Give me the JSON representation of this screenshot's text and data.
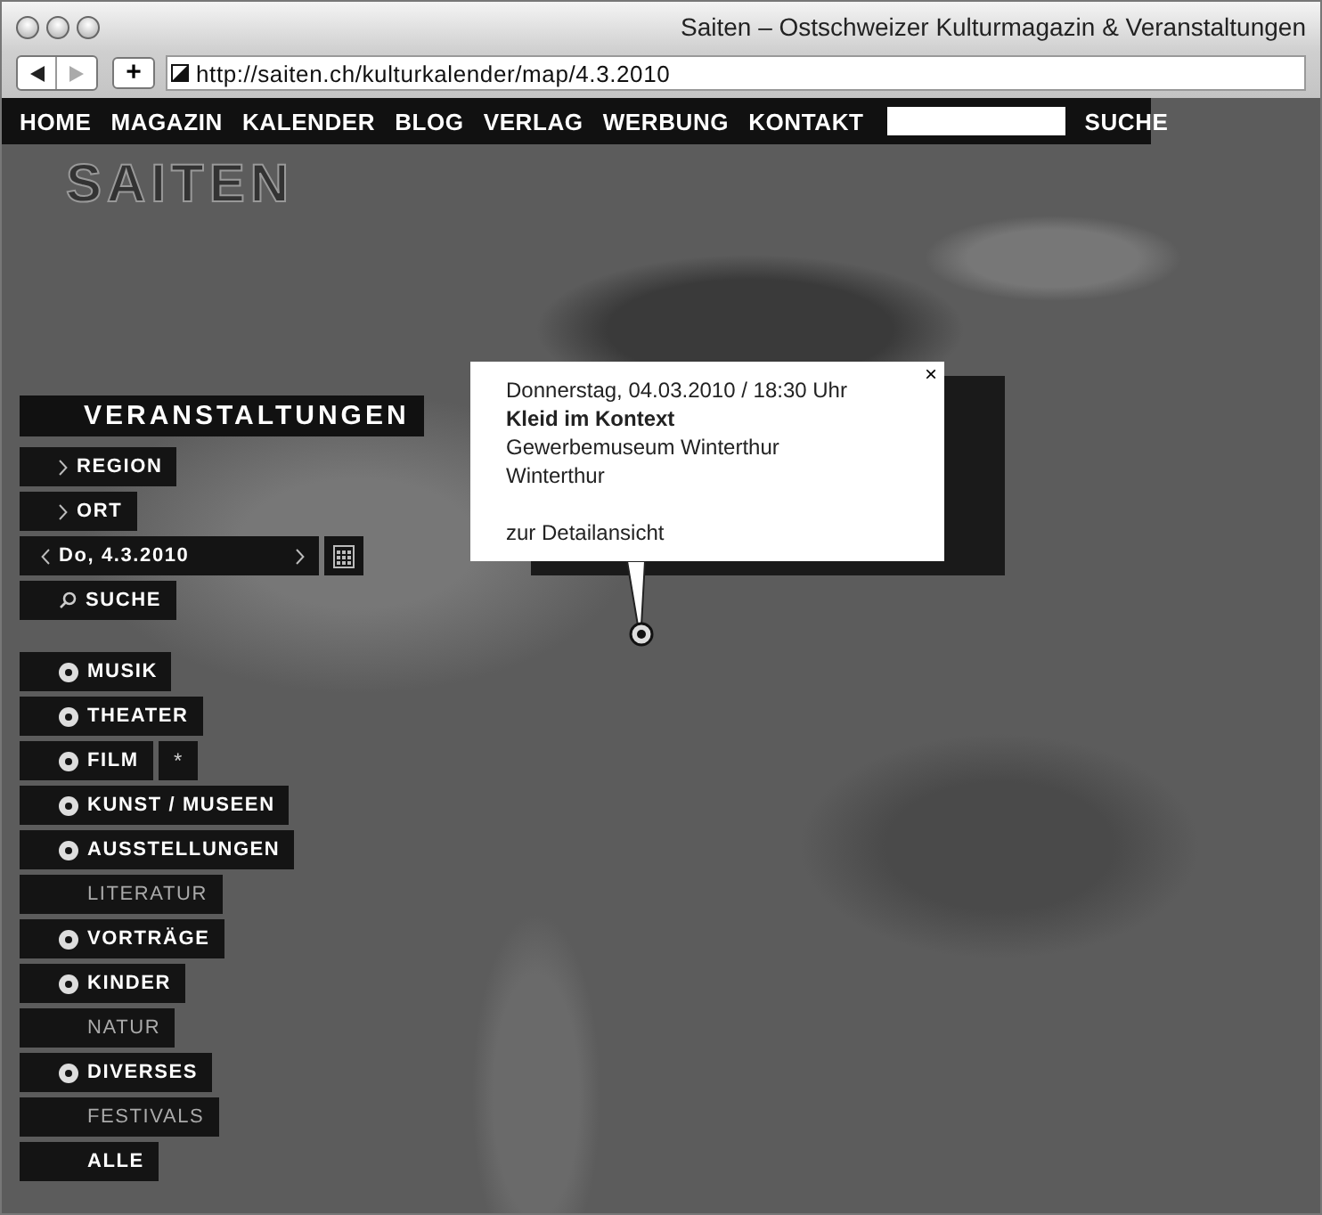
{
  "window": {
    "title": "Saiten – Ostschweizer Kulturmagazin & Veranstaltungen",
    "url": "http://saiten.ch/kulturkalender/map/4.3.2010",
    "bookmark_button": "+"
  },
  "nav": {
    "items": [
      "HOME",
      "MAGAZIN",
      "KALENDER",
      "BLOG",
      "VERLAG",
      "WERBUNG",
      "KONTAKT"
    ],
    "search_button": "SUCHE"
  },
  "logo": "SAITEN",
  "sidebar": {
    "heading": "VERANSTALTUNGEN",
    "filters": [
      {
        "kind": "link",
        "label": "REGION"
      },
      {
        "kind": "link",
        "label": "ORT"
      },
      {
        "kind": "date",
        "label": "Do, 4.3.2010"
      },
      {
        "kind": "search",
        "label": "SUCHE"
      }
    ],
    "categories": [
      {
        "label": "MUSIK",
        "icon": true,
        "dimmed": false
      },
      {
        "label": "THEATER",
        "icon": true,
        "dimmed": false
      },
      {
        "label": "FILM",
        "icon": true,
        "dimmed": false,
        "extra": "*"
      },
      {
        "label": "KUNST / MUSEEN",
        "icon": true,
        "dimmed": false
      },
      {
        "label": "AUSSTELLUNGEN",
        "icon": true,
        "dimmed": false
      },
      {
        "label": "LITERATUR",
        "icon": false,
        "dimmed": true
      },
      {
        "label": "VORTRÄGE",
        "icon": true,
        "dimmed": false
      },
      {
        "label": "KINDER",
        "icon": true,
        "dimmed": false
      },
      {
        "label": "NATUR",
        "icon": false,
        "dimmed": true
      },
      {
        "label": "DIVERSES",
        "icon": true,
        "dimmed": false
      },
      {
        "label": "FESTIVALS",
        "icon": false,
        "dimmed": true
      },
      {
        "label": "ALLE",
        "icon": false,
        "dimmed": false
      }
    ]
  },
  "popup": {
    "close": "×",
    "date": "Donnerstag, 04.03.2010 / 18:30 Uhr",
    "title": "Kleid im Kontext",
    "venue": "Gewerbemuseum Winterthur",
    "city": "Winterthur",
    "link": "zur Detailansicht"
  }
}
